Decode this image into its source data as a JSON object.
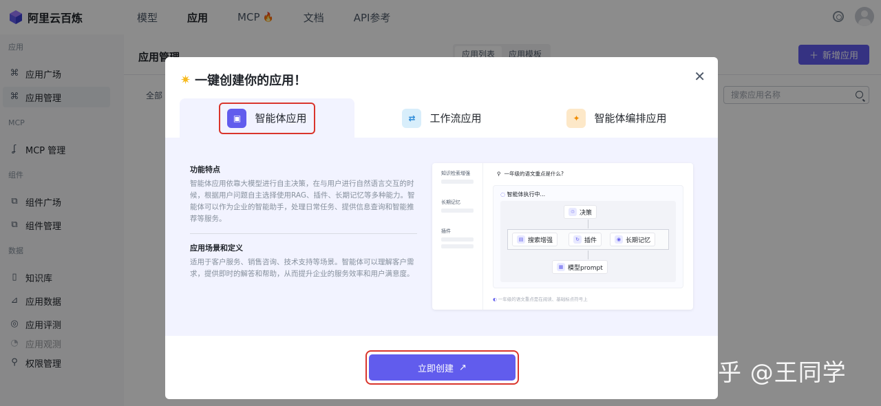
{
  "brand": {
    "name": "阿里云百炼"
  },
  "nav": {
    "items": [
      "模型",
      "应用",
      "MCP",
      "文档",
      "API参考"
    ],
    "fire_icon": "🔥"
  },
  "sidebar": {
    "groups": [
      {
        "label": "应用",
        "items": [
          {
            "label": "应用广场",
            "icon": "apps-icon"
          },
          {
            "label": "应用管理",
            "icon": "apps-icon"
          }
        ]
      },
      {
        "label": "MCP",
        "items": [
          {
            "label": "MCP 管理",
            "icon": "plug-icon"
          }
        ]
      },
      {
        "label": "组件",
        "items": [
          {
            "label": "组件广场",
            "icon": "component-icon"
          },
          {
            "label": "组件管理",
            "icon": "component-icon"
          }
        ]
      },
      {
        "label": "数据",
        "items": [
          {
            "label": "知识库",
            "icon": "book-icon"
          },
          {
            "label": "应用数据",
            "icon": "chart-icon"
          },
          {
            "label": "应用评测",
            "icon": "compass-icon"
          },
          {
            "label": "应用观测",
            "icon": "eye-icon"
          }
        ]
      },
      {
        "items": [
          {
            "label": "权限管理",
            "icon": "user-icon"
          }
        ]
      }
    ]
  },
  "main": {
    "title": "应用管理",
    "segments": [
      "应用列表",
      "应用模板"
    ],
    "new_button": "新增应用",
    "filter_all": "全部",
    "search_placeholder": "搜索应用名称"
  },
  "modal": {
    "title": "一键创建你的应用！",
    "tabs": [
      "智能体应用",
      "工作流应用",
      "智能体编排应用"
    ],
    "features_title": "功能特点",
    "features_text": "智能体应用依靠大模型进行自主决策，在与用户进行自然语言交互的时候，根据用户问题自主选择使用RAG、插件、长期记忆等多种能力。智能体可以作为企业的智能助手，处理日常任务、提供信息查询和智能推荐等服务。",
    "scenes_title": "应用场景和定义",
    "scenes_text": "适用于客户服务、销售咨询、技术支持等场景。智能体可以理解客户需求，提供即时的解答和帮助，从而提升企业的服务效率和用户满意度。",
    "preview": {
      "left_labels": [
        "知识检索增强",
        "长期记忆",
        "插件"
      ],
      "question": "一年级的语文重点是什么?",
      "executing": "智能体执行中...",
      "nodes": {
        "decision": "决策",
        "search": "搜索增强",
        "plugin": "插件",
        "memory": "长期记忆",
        "prompt": "模型prompt"
      },
      "footer": "一年级的语文重点是在阅读、基础标点符号上"
    },
    "create_button": "立即创建",
    "create_arrow": "↗"
  },
  "watermark": "知乎 @王同学",
  "colors": {
    "accent": "#615ced",
    "highlight_border": "#d9342b"
  }
}
